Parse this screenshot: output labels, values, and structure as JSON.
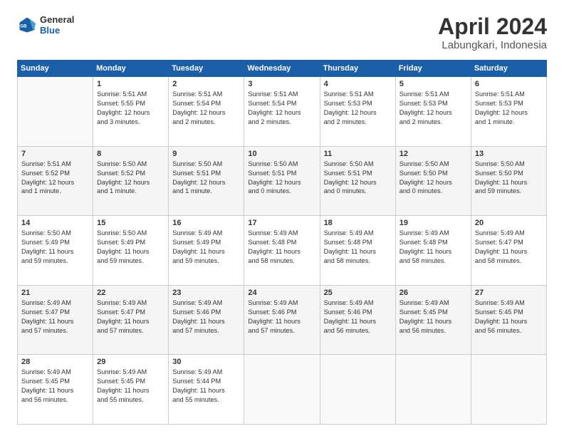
{
  "logo": {
    "general": "General",
    "blue": "Blue"
  },
  "title": {
    "month": "April 2024",
    "location": "Labungkari, Indonesia"
  },
  "headers": [
    "Sunday",
    "Monday",
    "Tuesday",
    "Wednesday",
    "Thursday",
    "Friday",
    "Saturday"
  ],
  "weeks": [
    [
      {
        "day": "",
        "info": ""
      },
      {
        "day": "1",
        "info": "Sunrise: 5:51 AM\nSunset: 5:55 PM\nDaylight: 12 hours\nand 3 minutes."
      },
      {
        "day": "2",
        "info": "Sunrise: 5:51 AM\nSunset: 5:54 PM\nDaylight: 12 hours\nand 2 minutes."
      },
      {
        "day": "3",
        "info": "Sunrise: 5:51 AM\nSunset: 5:54 PM\nDaylight: 12 hours\nand 2 minutes."
      },
      {
        "day": "4",
        "info": "Sunrise: 5:51 AM\nSunset: 5:53 PM\nDaylight: 12 hours\nand 2 minutes."
      },
      {
        "day": "5",
        "info": "Sunrise: 5:51 AM\nSunset: 5:53 PM\nDaylight: 12 hours\nand 2 minutes."
      },
      {
        "day": "6",
        "info": "Sunrise: 5:51 AM\nSunset: 5:53 PM\nDaylight: 12 hours\nand 1 minute."
      }
    ],
    [
      {
        "day": "7",
        "info": "Sunrise: 5:51 AM\nSunset: 5:52 PM\nDaylight: 12 hours\nand 1 minute."
      },
      {
        "day": "8",
        "info": "Sunrise: 5:50 AM\nSunset: 5:52 PM\nDaylight: 12 hours\nand 1 minute."
      },
      {
        "day": "9",
        "info": "Sunrise: 5:50 AM\nSunset: 5:51 PM\nDaylight: 12 hours\nand 1 minute."
      },
      {
        "day": "10",
        "info": "Sunrise: 5:50 AM\nSunset: 5:51 PM\nDaylight: 12 hours\nand 0 minutes."
      },
      {
        "day": "11",
        "info": "Sunrise: 5:50 AM\nSunset: 5:51 PM\nDaylight: 12 hours\nand 0 minutes."
      },
      {
        "day": "12",
        "info": "Sunrise: 5:50 AM\nSunset: 5:50 PM\nDaylight: 12 hours\nand 0 minutes."
      },
      {
        "day": "13",
        "info": "Sunrise: 5:50 AM\nSunset: 5:50 PM\nDaylight: 11 hours\nand 59 minutes."
      }
    ],
    [
      {
        "day": "14",
        "info": "Sunrise: 5:50 AM\nSunset: 5:49 PM\nDaylight: 11 hours\nand 59 minutes."
      },
      {
        "day": "15",
        "info": "Sunrise: 5:50 AM\nSunset: 5:49 PM\nDaylight: 11 hours\nand 59 minutes."
      },
      {
        "day": "16",
        "info": "Sunrise: 5:49 AM\nSunset: 5:49 PM\nDaylight: 11 hours\nand 59 minutes."
      },
      {
        "day": "17",
        "info": "Sunrise: 5:49 AM\nSunset: 5:48 PM\nDaylight: 11 hours\nand 58 minutes."
      },
      {
        "day": "18",
        "info": "Sunrise: 5:49 AM\nSunset: 5:48 PM\nDaylight: 11 hours\nand 58 minutes."
      },
      {
        "day": "19",
        "info": "Sunrise: 5:49 AM\nSunset: 5:48 PM\nDaylight: 11 hours\nand 58 minutes."
      },
      {
        "day": "20",
        "info": "Sunrise: 5:49 AM\nSunset: 5:47 PM\nDaylight: 11 hours\nand 58 minutes."
      }
    ],
    [
      {
        "day": "21",
        "info": "Sunrise: 5:49 AM\nSunset: 5:47 PM\nDaylight: 11 hours\nand 57 minutes."
      },
      {
        "day": "22",
        "info": "Sunrise: 5:49 AM\nSunset: 5:47 PM\nDaylight: 11 hours\nand 57 minutes."
      },
      {
        "day": "23",
        "info": "Sunrise: 5:49 AM\nSunset: 5:46 PM\nDaylight: 11 hours\nand 57 minutes."
      },
      {
        "day": "24",
        "info": "Sunrise: 5:49 AM\nSunset: 5:46 PM\nDaylight: 11 hours\nand 57 minutes."
      },
      {
        "day": "25",
        "info": "Sunrise: 5:49 AM\nSunset: 5:46 PM\nDaylight: 11 hours\nand 56 minutes."
      },
      {
        "day": "26",
        "info": "Sunrise: 5:49 AM\nSunset: 5:45 PM\nDaylight: 11 hours\nand 56 minutes."
      },
      {
        "day": "27",
        "info": "Sunrise: 5:49 AM\nSunset: 5:45 PM\nDaylight: 11 hours\nand 56 minutes."
      }
    ],
    [
      {
        "day": "28",
        "info": "Sunrise: 5:49 AM\nSunset: 5:45 PM\nDaylight: 11 hours\nand 56 minutes."
      },
      {
        "day": "29",
        "info": "Sunrise: 5:49 AM\nSunset: 5:45 PM\nDaylight: 11 hours\nand 55 minutes."
      },
      {
        "day": "30",
        "info": "Sunrise: 5:49 AM\nSunset: 5:44 PM\nDaylight: 11 hours\nand 55 minutes."
      },
      {
        "day": "",
        "info": ""
      },
      {
        "day": "",
        "info": ""
      },
      {
        "day": "",
        "info": ""
      },
      {
        "day": "",
        "info": ""
      }
    ]
  ]
}
